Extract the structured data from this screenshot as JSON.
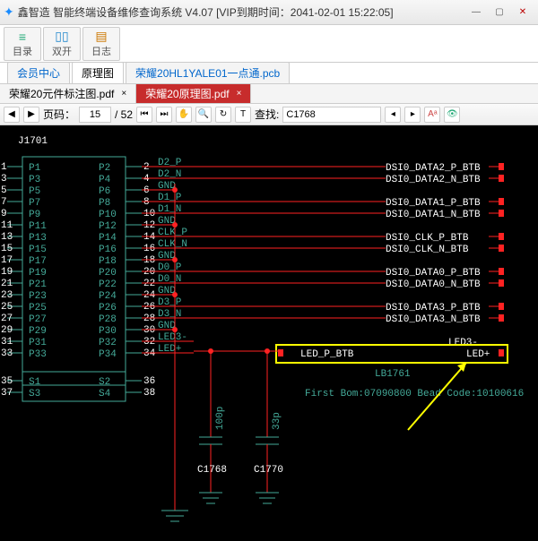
{
  "window": {
    "title": "鑫智造 智能终端设备维修查询系统 V4.07 [VIP到期时间：2041-02-01 15:22:05]"
  },
  "ribbon": {
    "btn1": "目录",
    "btn2": "双开",
    "btn3": "日志"
  },
  "maintabs": {
    "t1": "会员中心",
    "t2": "原理图",
    "t3": "荣耀20HL1YALE01一点通.pcb"
  },
  "doctabs": {
    "d1": "荣耀20元件标注图.pdf",
    "d2": "荣耀20原理图.pdf"
  },
  "toolbar": {
    "page_label": "页码：",
    "page": "15",
    "page_total": "/ 52",
    "search_label": "查找:",
    "search": "C1768"
  },
  "schematic": {
    "component_ref": "J1701",
    "left_pins": [
      {
        "num": "1",
        "name": "P1"
      },
      {
        "num": "3",
        "name": "P3"
      },
      {
        "num": "5",
        "name": "P5"
      },
      {
        "num": "7",
        "name": "P7"
      },
      {
        "num": "9",
        "name": "P9"
      },
      {
        "num": "11",
        "name": "P11"
      },
      {
        "num": "13",
        "name": "P13"
      },
      {
        "num": "15",
        "name": "P15"
      },
      {
        "num": "17",
        "name": "P17"
      },
      {
        "num": "19",
        "name": "P19"
      },
      {
        "num": "21",
        "name": "P21"
      },
      {
        "num": "23",
        "name": "P23"
      },
      {
        "num": "25",
        "name": "P25"
      },
      {
        "num": "27",
        "name": "P27"
      },
      {
        "num": "29",
        "name": "P29"
      },
      {
        "num": "31",
        "name": "P31"
      },
      {
        "num": "33",
        "name": "P33"
      }
    ],
    "bottom_left_pins": [
      {
        "num": "35",
        "name": "S1"
      },
      {
        "num": "37",
        "name": "S3"
      }
    ],
    "right_pins": [
      {
        "num": "2",
        "name": "P2",
        "net": "D2_P"
      },
      {
        "num": "4",
        "name": "P4",
        "net": "D2_N"
      },
      {
        "num": "6",
        "name": "P6",
        "net": "GND"
      },
      {
        "num": "8",
        "name": "P8",
        "net": "D1_P"
      },
      {
        "num": "10",
        "name": "P10",
        "net": "D1_N"
      },
      {
        "num": "12",
        "name": "P12",
        "net": "GND"
      },
      {
        "num": "14",
        "name": "P14",
        "net": "CLK_P"
      },
      {
        "num": "16",
        "name": "P16",
        "net": "CLK_N"
      },
      {
        "num": "18",
        "name": "P18",
        "net": "GND"
      },
      {
        "num": "20",
        "name": "P20",
        "net": "D0_P"
      },
      {
        "num": "22",
        "name": "P22",
        "net": "D0_N"
      },
      {
        "num": "24",
        "name": "P24",
        "net": "GND"
      },
      {
        "num": "26",
        "name": "P26",
        "net": "D3_P"
      },
      {
        "num": "28",
        "name": "P28",
        "net": "D3_N"
      },
      {
        "num": "30",
        "name": "P30",
        "net": "GND"
      },
      {
        "num": "32",
        "name": "P32",
        "net": "LED3-"
      },
      {
        "num": "34",
        "name": "P34",
        "net": "LED+"
      }
    ],
    "bottom_right_pins": [
      {
        "num": "36",
        "name": "S2"
      },
      {
        "num": "38",
        "name": "S4"
      }
    ],
    "right_labels": [
      "DSI0_DATA2_P_BTB",
      "DSI0_DATA2_N_BTB",
      "DSI0_DATA1_P_BTB",
      "DSI0_DATA1_N_BTB",
      "DSI0_CLK_P_BTB",
      "DSI0_CLK_N_BTB",
      "DSI0_DATA0_P_BTB",
      "DSI0_DATA0_N_BTB",
      "DSI0_DATA3_P_BTB",
      "DSI0_DATA3_N_BTB",
      "LED3-",
      "LED+"
    ],
    "hl_left": "LED_P_BTB",
    "hl_right": "LED+",
    "lb_ref": "LB1761",
    "bom_line": "First Bom:07090800  Bead Code:10100616",
    "cap1_ref": "C1768",
    "cap1_val": "100p",
    "cap2_ref": "C1770",
    "cap2_val": "33p"
  }
}
